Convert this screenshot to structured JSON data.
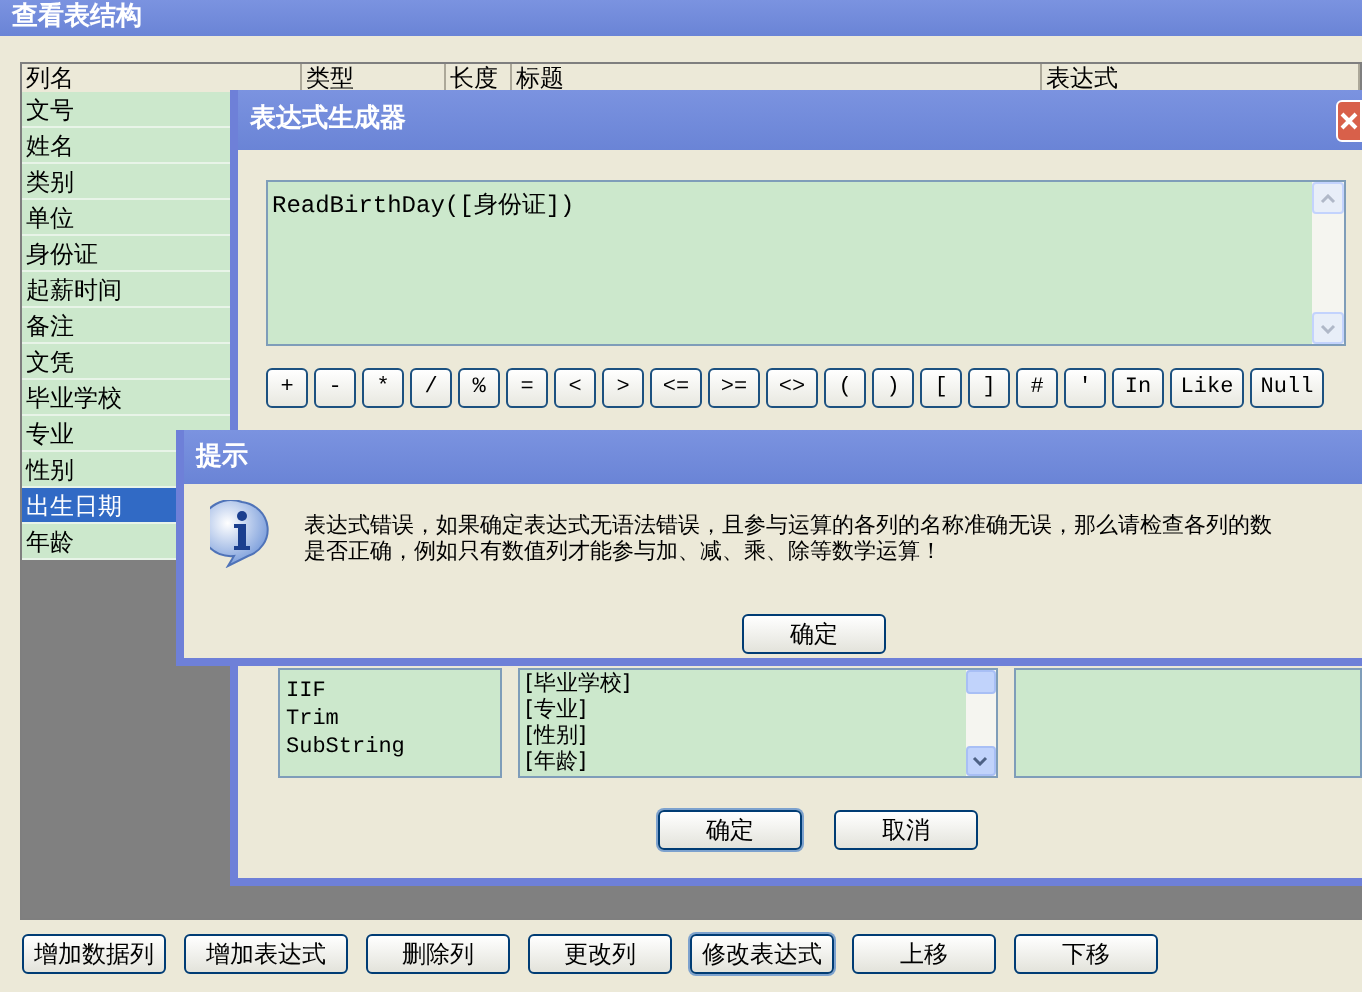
{
  "main_window": {
    "title": "查看表结构",
    "table": {
      "columns": [
        "列名",
        "类型",
        "长度",
        "标题",
        "表达式"
      ],
      "rows": [
        {
          "name": "文号",
          "selected": false
        },
        {
          "name": "姓名",
          "selected": false
        },
        {
          "name": "类别",
          "selected": false
        },
        {
          "name": "单位",
          "selected": false
        },
        {
          "name": "身份证",
          "selected": false
        },
        {
          "name": "起薪时间",
          "selected": false
        },
        {
          "name": "备注",
          "selected": false
        },
        {
          "name": "文凭",
          "selected": false
        },
        {
          "name": "毕业学校",
          "selected": false
        },
        {
          "name": "专业",
          "selected": false
        },
        {
          "name": "性别",
          "selected": false
        },
        {
          "name": "出生日期",
          "selected": true
        },
        {
          "name": "年龄",
          "selected": false
        }
      ]
    },
    "buttons": [
      {
        "label": "增加数据列",
        "focused": false
      },
      {
        "label": "增加表达式",
        "focused": false
      },
      {
        "label": "删除列",
        "focused": false
      },
      {
        "label": "更改列",
        "focused": false
      },
      {
        "label": "修改表达式",
        "focused": true
      },
      {
        "label": "上移",
        "focused": false
      },
      {
        "label": "下移",
        "focused": false
      }
    ]
  },
  "expression_builder": {
    "title": "表达式生成器",
    "expression": "ReadBirthDay([身份证])",
    "operators": [
      "+",
      "-",
      "*",
      "/",
      "%",
      "=",
      "<",
      ">",
      "<=",
      ">=",
      "<>",
      "(",
      ")",
      "[",
      "]",
      "#",
      "'",
      "In",
      "Like",
      "Null"
    ],
    "functions": [
      "IIF",
      "Trim",
      "SubString"
    ],
    "column_list": [
      "[毕业学校]",
      "[专业]",
      "[性别]",
      "[年龄]"
    ],
    "buttons": [
      {
        "label": "确定",
        "focused": true
      },
      {
        "label": "取消",
        "focused": false
      }
    ]
  },
  "message_box": {
    "title": "提示",
    "lines": [
      "表达式错误，如果确定表达式无语法错误，且参与运算的各列的名称准确无误，那么请检查各列的数",
      "是否正确，例如只有数值列才能参与加、减、乘、除等数学运算！"
    ],
    "button": "确定"
  }
}
